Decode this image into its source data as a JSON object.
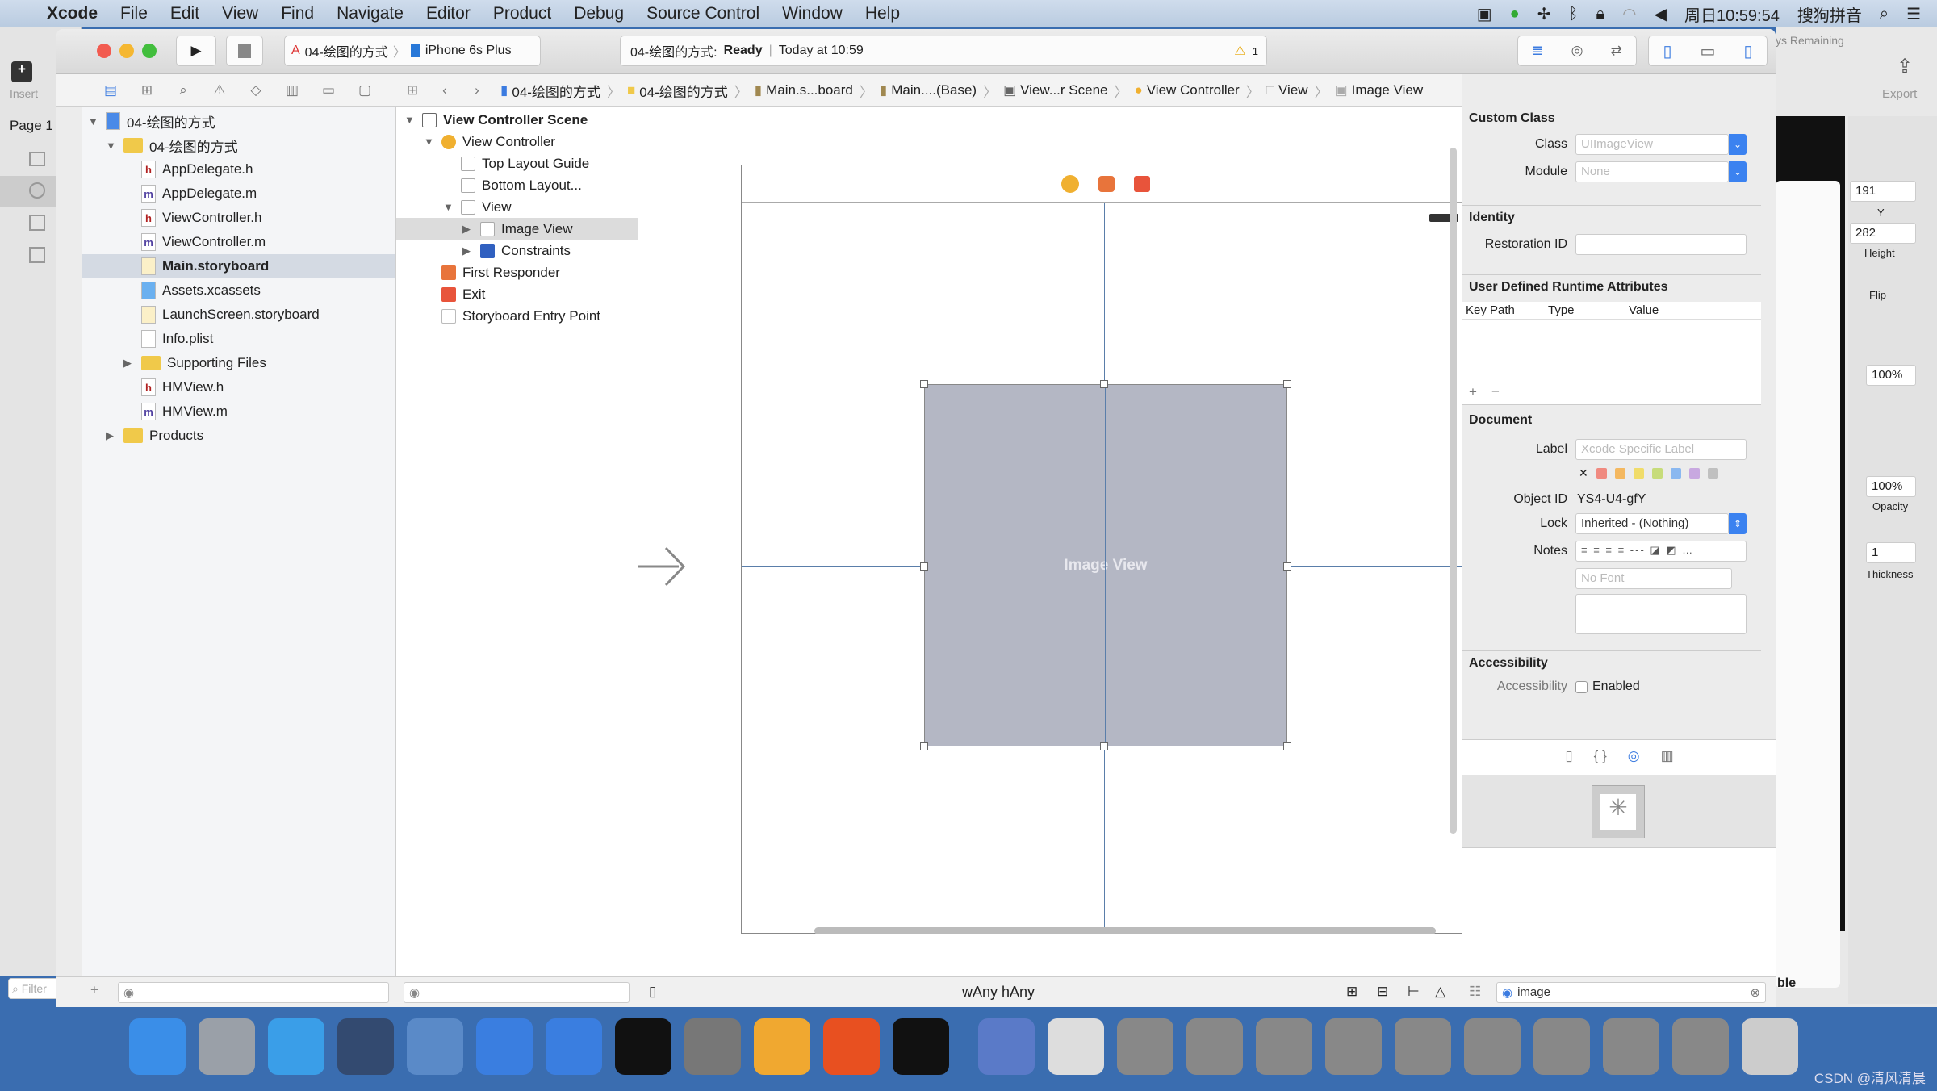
{
  "menubar": {
    "apple": "",
    "app": "Xcode",
    "items": [
      "File",
      "Edit",
      "View",
      "Find",
      "Navigate",
      "Editor",
      "Product",
      "Debug",
      "Source Control",
      "Window",
      "Help"
    ],
    "clock": "周日10:59:54",
    "ime": "搜狗拼音"
  },
  "bg_left": {
    "insert": "Insert",
    "page": "Page 1",
    "filter": "Filter"
  },
  "bg_right": {
    "remaining": "ys Remaining",
    "export": "Export",
    "y_value": "191",
    "y_label": "Y",
    "height_value": "282",
    "height_label": "Height",
    "flip_label": "Flip",
    "pct1": "100%",
    "opacity_value": "100%",
    "opacity_label": "Opacity",
    "thickness_value": "1",
    "thickness_label": "Thickness",
    "ble": "ble"
  },
  "toolbar": {
    "scheme": "04-绘图的方式",
    "device": "iPhone 6s Plus",
    "activity_project": "04-绘图的方式:",
    "activity_status": "Ready",
    "activity_time": "Today at 10:59",
    "warning_count": "1"
  },
  "breadcrumbs": [
    "04-绘图的方式",
    "04-绘图的方式",
    "Main.s...board",
    "Main....(Base)",
    "View...r Scene",
    "View Controller",
    "View",
    "Image View"
  ],
  "navigator": {
    "items": [
      {
        "label": "04-绘图的方式",
        "type": "project",
        "depth": 0,
        "tri": "▼"
      },
      {
        "label": "04-绘图的方式",
        "type": "folder",
        "depth": 1,
        "tri": "▼"
      },
      {
        "label": "AppDelegate.h",
        "type": "h",
        "depth": 2
      },
      {
        "label": "AppDelegate.m",
        "type": "m",
        "depth": 2
      },
      {
        "label": "ViewController.h",
        "type": "h",
        "depth": 2
      },
      {
        "label": "ViewController.m",
        "type": "m",
        "depth": 2
      },
      {
        "label": "Main.storyboard",
        "type": "sb",
        "depth": 2,
        "selected": true
      },
      {
        "label": "Assets.xcassets",
        "type": "assets",
        "depth": 2
      },
      {
        "label": "LaunchScreen.storyboard",
        "type": "sb",
        "depth": 2
      },
      {
        "label": "Info.plist",
        "type": "plist",
        "depth": 2
      },
      {
        "label": "Supporting Files",
        "type": "folder",
        "depth": 2,
        "tri": "▶"
      },
      {
        "label": "HMView.h",
        "type": "h",
        "depth": 2
      },
      {
        "label": "HMView.m",
        "type": "m",
        "depth": 2
      },
      {
        "label": "Products",
        "type": "folder",
        "depth": 1,
        "tri": "▶"
      }
    ]
  },
  "outline": {
    "items": [
      {
        "label": "View Controller Scene",
        "depth": 0,
        "tri": "▼",
        "bold": true
      },
      {
        "label": "View Controller",
        "depth": 1,
        "tri": "▼"
      },
      {
        "label": "Top Layout Guide",
        "depth": 2
      },
      {
        "label": "Bottom Layout...",
        "depth": 2
      },
      {
        "label": "View",
        "depth": 2,
        "tri": "▼"
      },
      {
        "label": "Image View",
        "depth": 3,
        "tri": "▶",
        "selected": true
      },
      {
        "label": "Constraints",
        "depth": 3,
        "tri": "▶"
      },
      {
        "label": "First Responder",
        "depth": 1
      },
      {
        "label": "Exit",
        "depth": 1
      },
      {
        "label": "Storyboard Entry Point",
        "depth": 1
      }
    ]
  },
  "canvas": {
    "image_view_label": "Image View",
    "size_class_w": "wAny",
    "size_class_h": "hAny"
  },
  "inspector": {
    "custom_class_title": "Custom Class",
    "class_label": "Class",
    "class_placeholder": "UIImageView",
    "module_label": "Module",
    "module_placeholder": "None",
    "identity_title": "Identity",
    "restoration_label": "Restoration ID",
    "udra_title": "User Defined Runtime Attributes",
    "col_keypath": "Key Path",
    "col_type": "Type",
    "col_value": "Value",
    "document_title": "Document",
    "label_label": "Label",
    "label_placeholder": "Xcode Specific Label",
    "label_colors": [
      "#f08a80",
      "#f4b860",
      "#f0dc6a",
      "#c7dc7a",
      "#8ab8f0",
      "#c8a8e0",
      "#c0c0c0"
    ],
    "object_id_label": "Object ID",
    "object_id": "YS4-U4-gfY",
    "lock_label": "Lock",
    "lock_value": "Inherited - (Nothing)",
    "notes_label": "Notes",
    "font_placeholder": "No Font",
    "accessibility_title": "Accessibility",
    "accessibility_label": "Accessibility",
    "enabled_label": "Enabled",
    "library_search": "image"
  },
  "watermark": "CSDN @清风清晨"
}
